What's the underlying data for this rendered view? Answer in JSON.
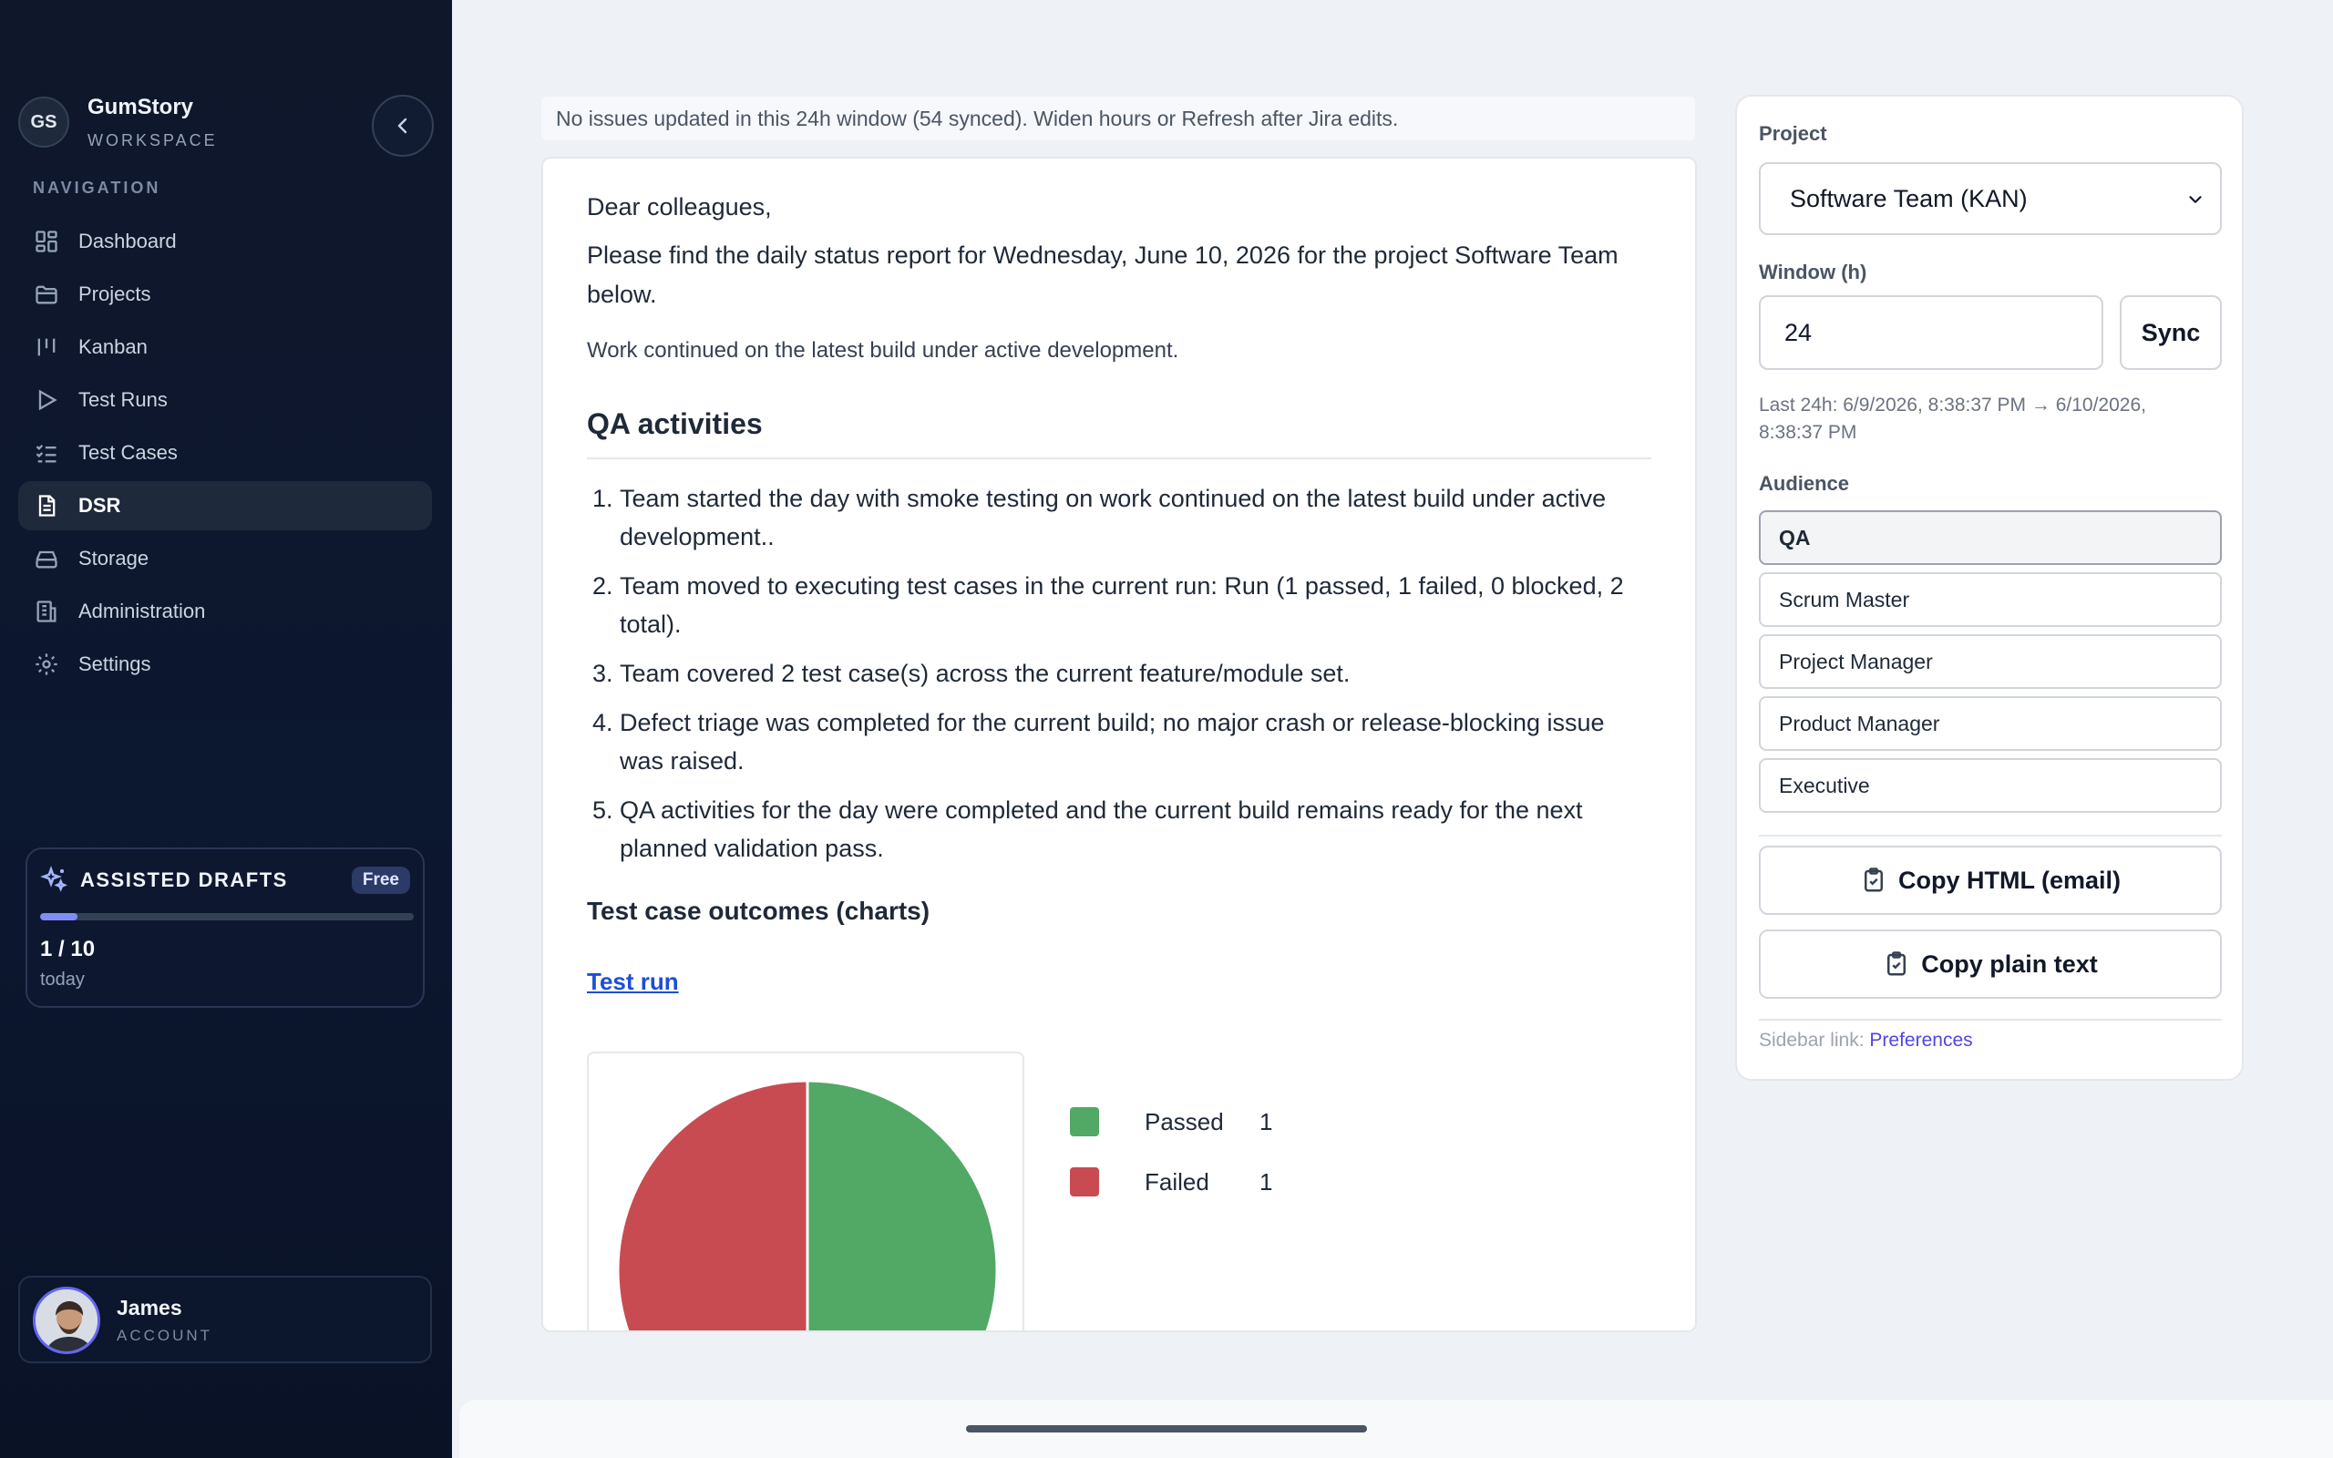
{
  "brand": {
    "badge": "GS",
    "name": "GumStory",
    "subtitle": "WORKSPACE"
  },
  "nav": {
    "heading": "NAVIGATION",
    "items": [
      {
        "label": "Dashboard",
        "icon": "dashboard-icon"
      },
      {
        "label": "Projects",
        "icon": "folder-icon"
      },
      {
        "label": "Kanban",
        "icon": "kanban-icon"
      },
      {
        "label": "Test Runs",
        "icon": "play-icon"
      },
      {
        "label": "Test Cases",
        "icon": "checklist-icon"
      },
      {
        "label": "DSR",
        "icon": "document-icon",
        "active": true
      },
      {
        "label": "Storage",
        "icon": "storage-icon"
      },
      {
        "label": "Administration",
        "icon": "building-icon"
      },
      {
        "label": "Settings",
        "icon": "gear-icon"
      }
    ]
  },
  "drafts": {
    "title": "ASSISTED DRAFTS",
    "badge": "Free",
    "count": "1 / 10",
    "subtitle": "today",
    "used": 1,
    "limit": 10
  },
  "account": {
    "name": "James",
    "subtitle": "ACCOUNT"
  },
  "notice": "No issues updated in this 24h window (54 synced). Widen hours or Refresh after Jira edits.",
  "report": {
    "greeting": "Dear colleagues,",
    "intro": "Please find the daily status report for Wednesday, June 10, 2026 for the project Software Team below.",
    "summary": "Work continued on the latest build under active development.",
    "qa_title": "QA activities",
    "activities": [
      "Team started the day with smoke testing on work continued on the latest build under active development..",
      "Team moved to executing test cases in the current run: Run (1 passed, 1 failed, 0 blocked, 2 total).",
      "Team covered 2 test case(s) across the current feature/module set.",
      "Defect triage was completed for the current build; no major crash or release-blocking issue was raised.",
      "QA activities for the day were completed and the current build remains ready for the next planned validation pass."
    ],
    "outcomes_title": "Test case outcomes (charts)",
    "test_run_link": "Test run"
  },
  "chart_data": {
    "type": "pie",
    "categories": [
      "Passed",
      "Failed"
    ],
    "values": [
      1,
      1
    ],
    "colors": [
      "#52a865",
      "#c84b51"
    ],
    "legend": "right"
  },
  "panel": {
    "project_label": "Project",
    "project_value": "Software Team (KAN)",
    "window_label": "Window (h)",
    "window_value": "24",
    "sync_label": "Sync",
    "range_text": "Last 24h: 6/9/2026, 8:38:37 PM → 6/10/2026, 8:38:37 PM",
    "audience_label": "Audience",
    "audiences": [
      "QA",
      "Scrum Master",
      "Project Manager",
      "Product Manager",
      "Executive"
    ],
    "selected_audience": "QA",
    "copy_html_label": "Copy HTML (email)",
    "copy_text_label": "Copy plain text",
    "pref_prefix": "Sidebar link:",
    "pref_link": "Preferences"
  }
}
